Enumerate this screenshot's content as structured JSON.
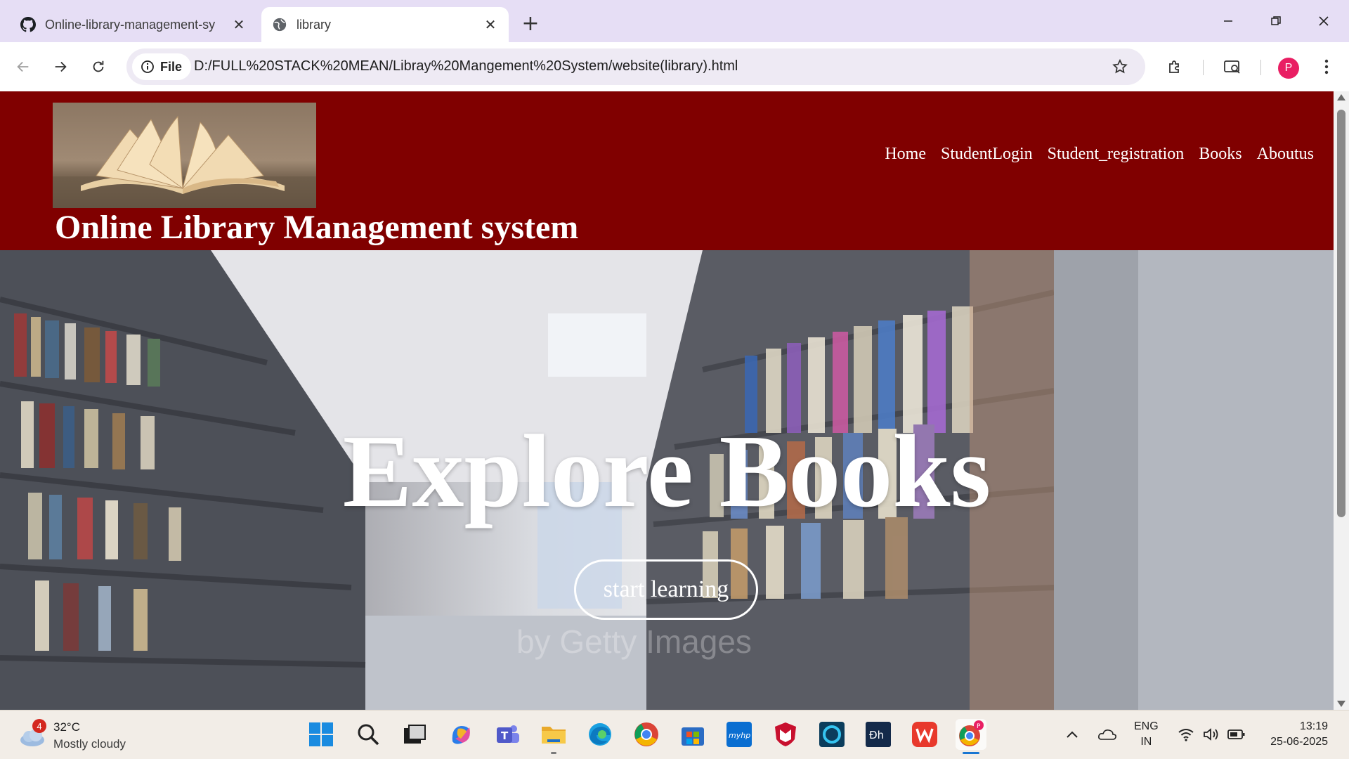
{
  "browser": {
    "tabs": [
      {
        "title": "Online-library-management-sy",
        "icon": "github-icon"
      },
      {
        "title": "library",
        "icon": "globe-icon"
      }
    ],
    "omnibox": {
      "scheme_label": "File",
      "url": "D:/FULL%20STACK%20MEAN/Libray%20Mangement%20System/website(library).html"
    },
    "profile_initial": "P"
  },
  "site": {
    "title": "Online Library Management system",
    "nav": [
      "Home",
      "StudentLogin",
      "Student_registration",
      "Books",
      "Aboutus"
    ],
    "hero_title": "Explore Books",
    "cta_label": "start learning",
    "watermark": "by Getty Images",
    "header_color": "#800000"
  },
  "taskbar": {
    "weather": {
      "badge": "4",
      "temp": "32°C",
      "desc": "Mostly cloudy"
    },
    "language": {
      "line1": "ENG",
      "line2": "IN"
    },
    "clock": {
      "time": "13:19",
      "date": "25-06-2025"
    }
  }
}
